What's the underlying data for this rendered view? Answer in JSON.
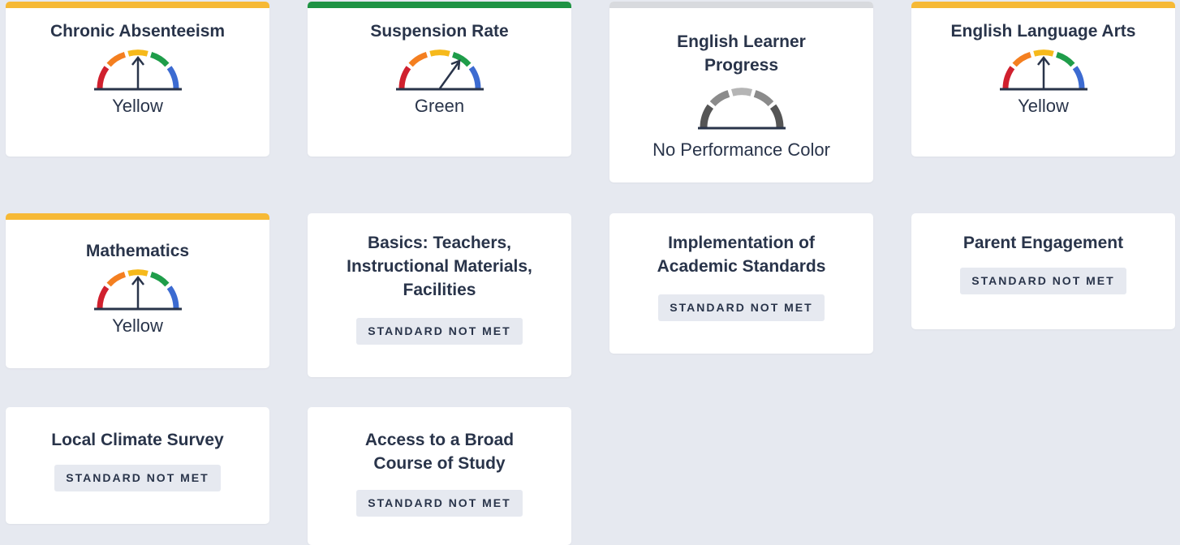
{
  "colors": {
    "yellow_bar": "#f6b936",
    "green_bar": "#1f9344",
    "gray_bar": "#d8dade",
    "gauge_red": "#d0202e",
    "gauge_orange": "#f47f20",
    "gauge_yellow": "#f6b91b",
    "gauge_green": "#1f9d4a",
    "gauge_blue": "#3c6bd1"
  },
  "cards": {
    "chronic": {
      "title": "Chronic Absenteeism",
      "level": "Yellow",
      "icon": "gauge-yellow-icon"
    },
    "suspension": {
      "title": "Suspension Rate",
      "level": "Green",
      "icon": "gauge-green-icon"
    },
    "elp": {
      "title": "English Learner Progress",
      "level": "No Performance Color",
      "icon": "gauge-gray-icon"
    },
    "ela": {
      "title": "English Language Arts",
      "level": "Yellow",
      "icon": "gauge-yellow-icon"
    },
    "math": {
      "title": "Mathematics",
      "level": "Yellow",
      "icon": "gauge-yellow-icon"
    },
    "basics": {
      "title": "Basics: Teachers, Instructional Materials, Facilities",
      "status": "STANDARD NOT MET"
    },
    "implementation": {
      "title": "Implementation of Academic Standards",
      "status": "STANDARD NOT MET"
    },
    "parent": {
      "title": "Parent Engagement",
      "status": "STANDARD NOT MET"
    },
    "climate": {
      "title": "Local Climate Survey",
      "status": "STANDARD NOT MET"
    },
    "access": {
      "title": "Access to a Broad Course of Study",
      "status": "STANDARD NOT MET"
    }
  }
}
